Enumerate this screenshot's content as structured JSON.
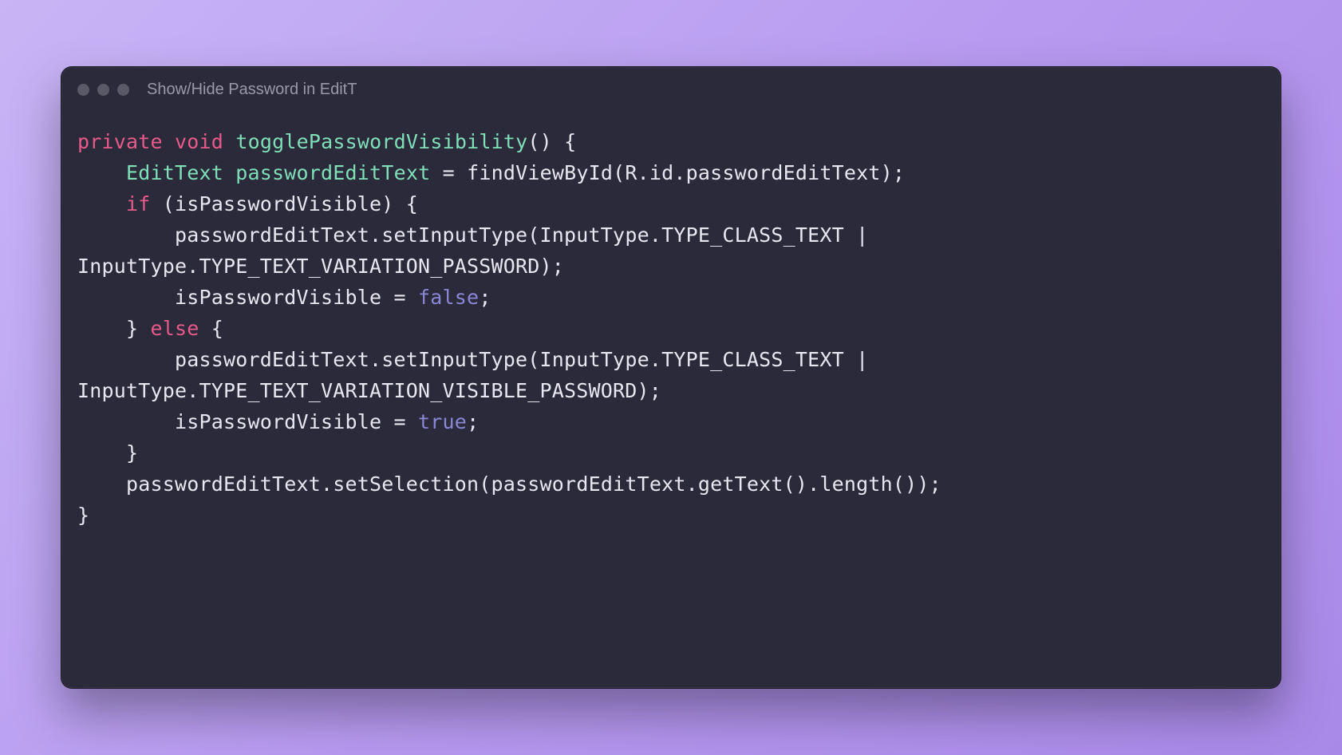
{
  "window": {
    "title": "Show/Hide Password in EditT"
  },
  "code": {
    "tokens": [
      {
        "t": "private",
        "c": "keyword"
      },
      {
        "t": " ",
        "c": "default"
      },
      {
        "t": "void",
        "c": "keyword"
      },
      {
        "t": " ",
        "c": "default"
      },
      {
        "t": "togglePasswordVisibility",
        "c": "method"
      },
      {
        "t": "() {",
        "c": "default"
      },
      {
        "t": "\n",
        "c": "default"
      },
      {
        "t": "    ",
        "c": "default"
      },
      {
        "t": "EditText",
        "c": "type"
      },
      {
        "t": " ",
        "c": "default"
      },
      {
        "t": "passwordEditText",
        "c": "type"
      },
      {
        "t": " = findViewById(R.id.passwordEditText);",
        "c": "default"
      },
      {
        "t": "\n",
        "c": "default"
      },
      {
        "t": "    ",
        "c": "default"
      },
      {
        "t": "if",
        "c": "keyword"
      },
      {
        "t": " (isPasswordVisible) {",
        "c": "default"
      },
      {
        "t": "\n",
        "c": "default"
      },
      {
        "t": "        passwordEditText.setInputType(InputType.TYPE_CLASS_TEXT | InputType.TYPE_TEXT_VARIATION_PASSWORD);",
        "c": "default"
      },
      {
        "t": "\n",
        "c": "default"
      },
      {
        "t": "        isPasswordVisible = ",
        "c": "default"
      },
      {
        "t": "false",
        "c": "literal"
      },
      {
        "t": ";",
        "c": "default"
      },
      {
        "t": "\n",
        "c": "default"
      },
      {
        "t": "    } ",
        "c": "default"
      },
      {
        "t": "else",
        "c": "keyword"
      },
      {
        "t": " {",
        "c": "default"
      },
      {
        "t": "\n",
        "c": "default"
      },
      {
        "t": "        passwordEditText.setInputType(InputType.TYPE_CLASS_TEXT | InputType.TYPE_TEXT_VARIATION_VISIBLE_PASSWORD);",
        "c": "default"
      },
      {
        "t": "\n",
        "c": "default"
      },
      {
        "t": "        isPasswordVisible = ",
        "c": "default"
      },
      {
        "t": "true",
        "c": "literal"
      },
      {
        "t": ";",
        "c": "default"
      },
      {
        "t": "\n",
        "c": "default"
      },
      {
        "t": "    }",
        "c": "default"
      },
      {
        "t": "\n",
        "c": "default"
      },
      {
        "t": "    passwordEditText.setSelection(passwordEditText.getText().length());",
        "c": "default"
      },
      {
        "t": "\n",
        "c": "default"
      },
      {
        "t": "}",
        "c": "default"
      }
    ]
  }
}
